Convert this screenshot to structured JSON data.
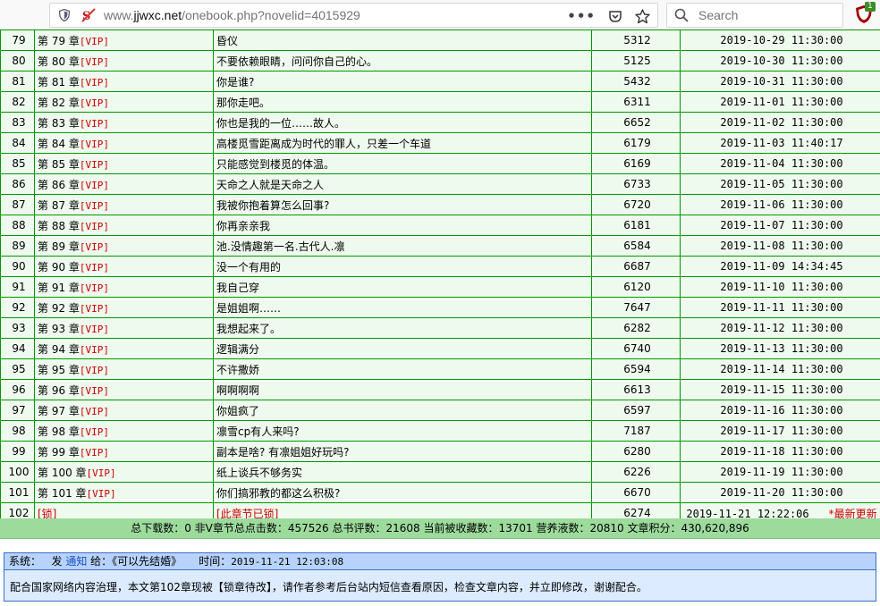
{
  "browser": {
    "url_prefix": "www.",
    "url_host": "jjwxc.net",
    "url_path": "/onebook.php?novelid=4015929",
    "search_placeholder": "Search",
    "ublock_badge": "1"
  },
  "table": {
    "rows": [
      {
        "num": "79",
        "chapter": "第 79 章",
        "vip": "[VIP]",
        "title": "昏仪",
        "words": "5312",
        "time": "2019-10-29 11:30:00"
      },
      {
        "num": "80",
        "chapter": "第 80 章",
        "vip": "[VIP]",
        "title": "不要依赖眼睛，问问你自己的心。",
        "words": "5125",
        "time": "2019-10-30 11:30:00"
      },
      {
        "num": "81",
        "chapter": "第 81 章",
        "vip": "[VIP]",
        "title": "你是谁?",
        "words": "5432",
        "time": "2019-10-31 11:30:00"
      },
      {
        "num": "82",
        "chapter": "第 82 章",
        "vip": "[VIP]",
        "title": "那你走吧。",
        "words": "6311",
        "time": "2019-11-01 11:30:00"
      },
      {
        "num": "83",
        "chapter": "第 83 章",
        "vip": "[VIP]",
        "title": "你也是我的一位……故人。",
        "words": "6652",
        "time": "2019-11-02 11:30:00"
      },
      {
        "num": "84",
        "chapter": "第 84 章",
        "vip": "[VIP]",
        "title": "高楼觅雪距离成为时代的罪人，只差一个车道",
        "words": "6179",
        "time": "2019-11-03 11:40:17"
      },
      {
        "num": "85",
        "chapter": "第 85 章",
        "vip": "[VIP]",
        "title": "只能感觉到楼觅的体温。",
        "words": "6169",
        "time": "2019-11-04 11:30:00"
      },
      {
        "num": "86",
        "chapter": "第 86 章",
        "vip": "[VIP]",
        "title": "天命之人就是天命之人",
        "words": "6733",
        "time": "2019-11-05 11:30:00"
      },
      {
        "num": "87",
        "chapter": "第 87 章",
        "vip": "[VIP]",
        "title": "我被你抱着算怎么回事?",
        "words": "6720",
        "time": "2019-11-06 11:30:00"
      },
      {
        "num": "88",
        "chapter": "第 88 章",
        "vip": "[VIP]",
        "title": "你再亲亲我",
        "words": "6181",
        "time": "2019-11-07 11:30:00"
      },
      {
        "num": "89",
        "chapter": "第 89 章",
        "vip": "[VIP]",
        "title": "池.没情趣第一名.古代人.凛",
        "words": "6584",
        "time": "2019-11-08 11:30:00"
      },
      {
        "num": "90",
        "chapter": "第 90 章",
        "vip": "[VIP]",
        "title": "没一个有用的",
        "words": "6687",
        "time": "2019-11-09 14:34:45"
      },
      {
        "num": "91",
        "chapter": "第 91 章",
        "vip": "[VIP]",
        "title": "我自己穿",
        "words": "6120",
        "time": "2019-11-10 11:30:00"
      },
      {
        "num": "92",
        "chapter": "第 92 章",
        "vip": "[VIP]",
        "title": "是姐姐啊……",
        "words": "7647",
        "time": "2019-11-11 11:30:00"
      },
      {
        "num": "93",
        "chapter": "第 93 章",
        "vip": "[VIP]",
        "title": "我想起来了。",
        "words": "6282",
        "time": "2019-11-12 11:30:00"
      },
      {
        "num": "94",
        "chapter": "第 94 章",
        "vip": "[VIP]",
        "title": "逻辑满分",
        "words": "6740",
        "time": "2019-11-13 11:30:00"
      },
      {
        "num": "95",
        "chapter": "第 95 章",
        "vip": "[VIP]",
        "title": "不许撒娇",
        "words": "6594",
        "time": "2019-11-14 11:30:00"
      },
      {
        "num": "96",
        "chapter": "第 96 章",
        "vip": "[VIP]",
        "title": "啊啊啊啊",
        "words": "6613",
        "time": "2019-11-15 11:30:00"
      },
      {
        "num": "97",
        "chapter": "第 97 章",
        "vip": "[VIP]",
        "title": "你姐疯了",
        "words": "6597",
        "time": "2019-11-16 11:30:00"
      },
      {
        "num": "98",
        "chapter": "第 98 章",
        "vip": "[VIP]",
        "title": "凛雪cp有人来吗?",
        "words": "7187",
        "time": "2019-11-17 11:30:00"
      },
      {
        "num": "99",
        "chapter": "第 99 章",
        "vip": "[VIP]",
        "title": "副本是啥? 有凛姐姐好玩吗?",
        "words": "6280",
        "time": "2019-11-18 11:30:00"
      },
      {
        "num": "100",
        "chapter": "第 100 章",
        "vip": "[VIP]",
        "title": "纸上谈兵不够务实",
        "words": "6226",
        "time": "2019-11-19 11:30:00"
      },
      {
        "num": "101",
        "chapter": "第 101 章",
        "vip": "[VIP]",
        "title": "你们搞邪教的都这么积极?",
        "words": "6670",
        "time": "2019-11-20 11:30:00"
      }
    ],
    "last_row": {
      "num": "102",
      "chapter": "[锁]",
      "title": "[此章节已锁]",
      "words": "6274",
      "time": "2019-11-21 12:22:06",
      "new_tag": "*最新更新"
    },
    "summary": "总下载数：0 非V章节总点击数：457526    总书评数：21608 当前被收藏数：13701 营养液数：20810 文章积分：430,620,896"
  },
  "notice": {
    "system_label": "系统：",
    "send_label": "发",
    "notify_link": "通知",
    "to_label": "给：《可以先结婚》",
    "time_label": "时间：",
    "time_value": "2019-11-21 12:03:08",
    "body": "配合国家网络内容治理，本文第102章现被【锁章待改】，请作者参考后台站内短信查看原因，检查文章内容，并立即修改，谢谢配合。"
  }
}
